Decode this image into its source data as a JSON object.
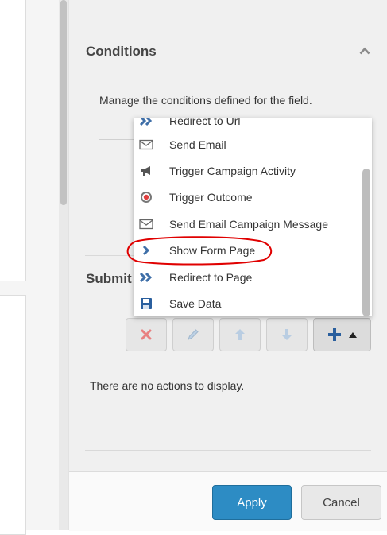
{
  "conditions": {
    "title": "Conditions",
    "description": "Manage the conditions defined for the field."
  },
  "submit": {
    "title_partial": "Submit",
    "empty_message": "There are no actions to display."
  },
  "dropdown": {
    "items": [
      {
        "label": "Redirect to Url",
        "icon": "double-chevron-icon"
      },
      {
        "label": "Send Email",
        "icon": "envelope-icon"
      },
      {
        "label": "Trigger Campaign Activity",
        "icon": "megaphone-icon"
      },
      {
        "label": "Trigger Outcome",
        "icon": "target-icon"
      },
      {
        "label": "Send Email Campaign Message",
        "icon": "envelope-icon"
      },
      {
        "label": "Show Form Page",
        "icon": "chevron-right-icon",
        "highlighted": true
      },
      {
        "label": "Redirect to Page",
        "icon": "double-chevron-icon"
      },
      {
        "label": "Save Data",
        "icon": "floppy-disk-icon"
      }
    ]
  },
  "toolbar": {
    "buttons": [
      "delete-icon",
      "edit-pencil-icon",
      "move-up-icon",
      "move-down-icon",
      "add-icon"
    ]
  },
  "footer": {
    "apply_label": "Apply",
    "cancel_label": "Cancel"
  },
  "colors": {
    "primary": "#2d8cc4",
    "delete": "#e06060",
    "icon_blue": "#3f6fa8",
    "annotation": "#e00000"
  }
}
